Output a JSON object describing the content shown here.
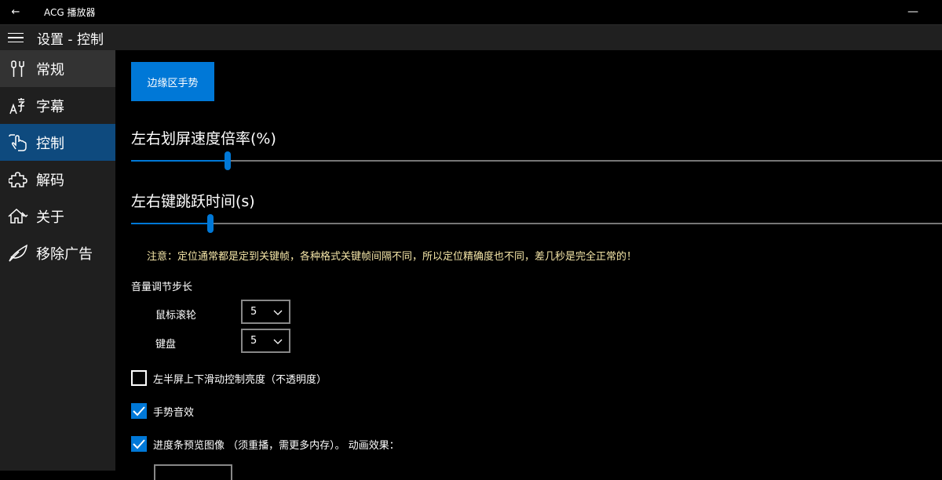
{
  "titlebar": {
    "back_glyph": "←",
    "app_title": "ACG 播放器",
    "minimize_glyph": "—"
  },
  "header": {
    "page_title": "设置 - 控制"
  },
  "sidebar": {
    "items": [
      {
        "label": "常规",
        "icon": "tools-icon"
      },
      {
        "label": "字幕",
        "icon": "subtitle-font-icon"
      },
      {
        "label": "控制",
        "icon": "touch-hand-icon"
      },
      {
        "label": "解码",
        "icon": "puzzle-icon"
      },
      {
        "label": "关于",
        "icon": "home-icon"
      },
      {
        "label": "移除广告",
        "icon": "leaf-icon"
      }
    ]
  },
  "main": {
    "edge_gesture_button": "边缘区手势",
    "slider1": {
      "label": "左右划屏速度倍率(%)",
      "value": 0.118
    },
    "slider2": {
      "label": "左右键跳跃时间(s)",
      "value": 0.097
    },
    "note": "注意：定位通常都是定到关键帧，各种格式关键帧间隔不同，所以定位精确度也不同，差几秒是完全正常的！",
    "volume": {
      "title": "音量调节步长",
      "mouse_label": "鼠标滚轮",
      "mouse_value": "5",
      "keyboard_label": "键盘",
      "keyboard_value": "5"
    },
    "checkboxes": [
      {
        "label": "左半屏上下滑动控制亮度（不透明度）",
        "checked": false
      },
      {
        "label": "手势音效",
        "checked": true
      },
      {
        "label": "进度条预览图像 （须重播，需更多内存）。 动画效果：",
        "checked": true
      }
    ]
  },
  "colors": {
    "accent": "#0078d7",
    "nav_active": "#0e4a7e",
    "note": "#f5e6a8"
  }
}
